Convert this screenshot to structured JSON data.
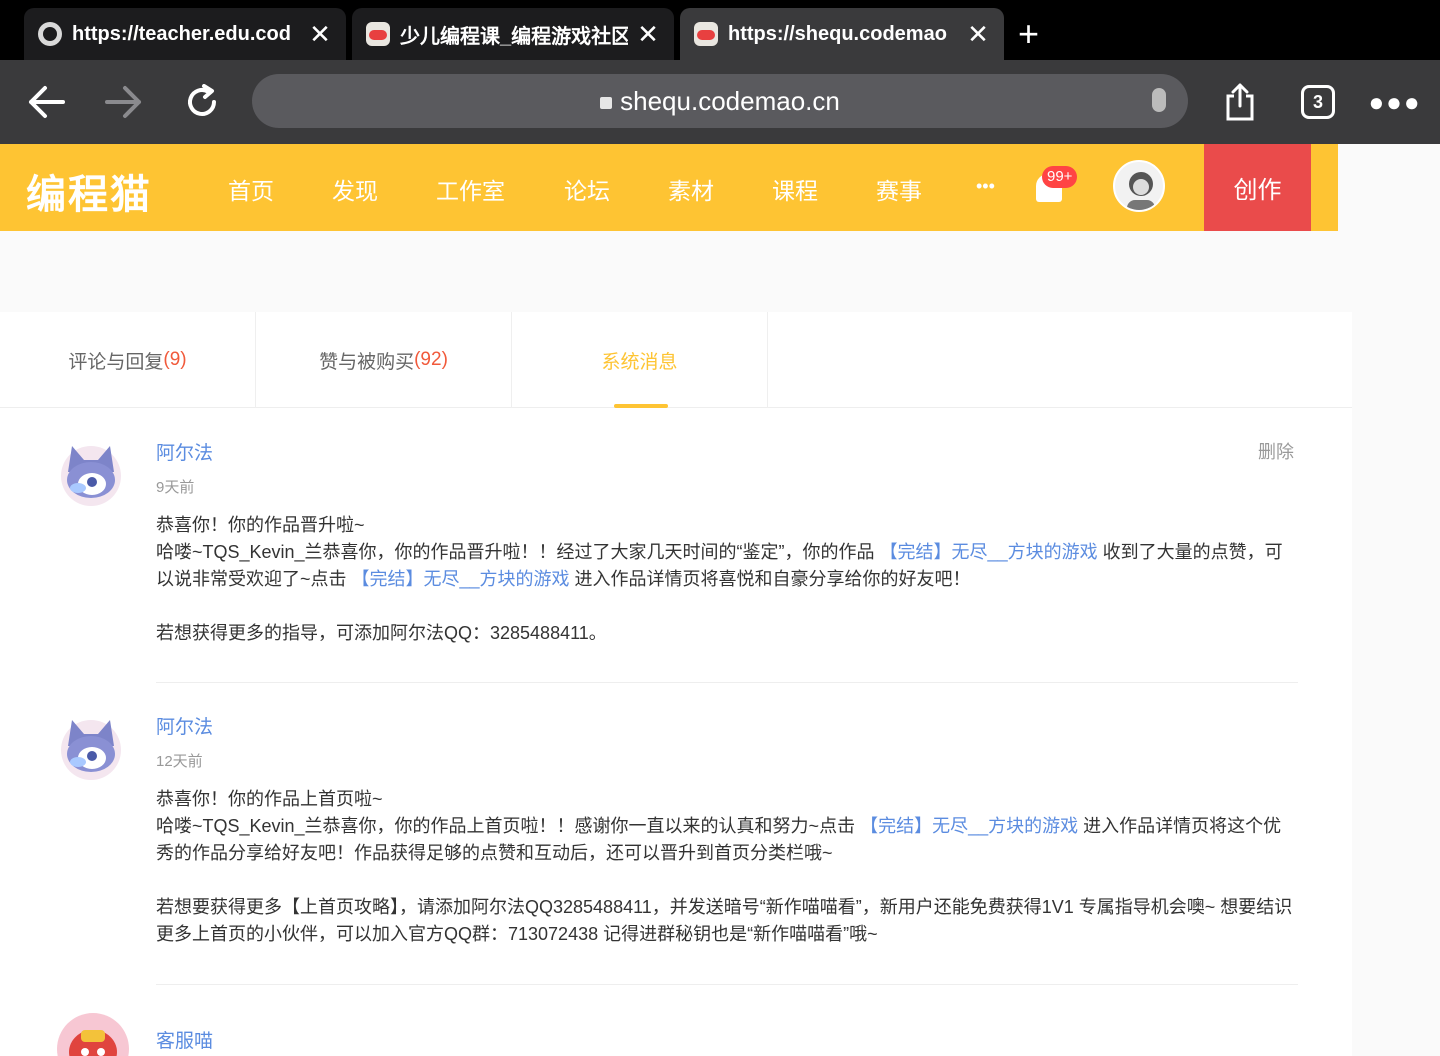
{
  "browser": {
    "tabs": [
      {
        "title": "https://teacher.edu.cod",
        "favicon": "globe-icon"
      },
      {
        "title": "少儿编程课_编程游戏社区",
        "favicon": "codemao-icon"
      },
      {
        "title": "https://shequ.codemao",
        "favicon": "codemao-icon"
      }
    ],
    "url": "sheq​u.codemao.cn",
    "tab_count": "3"
  },
  "site": {
    "logo": "编程猫",
    "nav": [
      "首页",
      "发现",
      "工作室",
      "论坛",
      "素材",
      "课程",
      "赛事",
      "•••"
    ],
    "notification_badge": "99+",
    "create_label": "创作",
    "brand_color": "#fec433"
  },
  "message_tabs": [
    {
      "label": "评论与回复",
      "count": "(9)"
    },
    {
      "label": "赞与被购买",
      "count": "(92)"
    },
    {
      "label": "系统消息",
      "count": ""
    }
  ],
  "messages": [
    {
      "sender": "阿尔法",
      "time": "9天前",
      "delete_label": "删除",
      "title": "恭喜你！你的作品晋升啦~",
      "line_a": "哈喽~TQS_Kevin_兰恭喜你，你的作品晋升啦！！经过了大家几天时间的“鉴定”，你的作品 ",
      "link_a": "【完结】无尽__方块的游戏",
      "line_b": " 收到了大量的点赞，可以说非常受欢迎了~点击 ",
      "link_b": "【完结】无尽__方块的游戏",
      "line_c": " 进入作品详情页将喜悦和自豪分享给你的好友吧！",
      "footer": "若想获得更多的指导，可添加阿尔法QQ：3285488411。"
    },
    {
      "sender": "阿尔法",
      "time": "12天前",
      "title": "恭喜你！你的作品上首页啦~",
      "line_a": "哈喽~TQS_Kevin_兰恭喜你，你的作品上首页啦！！感谢你一直以来的认真和努力~点击 ",
      "link_a": "【完结】无尽__方块的游戏",
      "line_b": " 进入作品详情页将这个优秀的作品分享给好友吧！作品获得足够的点赞和互动后，还可以晋升到首页分类栏哦~",
      "footer": "若想要获得更多【上首页攻略】，请添加阿尔法QQ3285488411，并发送暗号“新作喵喵看”，新用户还能免费获得1V1 专属指导机会噢~ 想要结识更多上首页的小伙伴，可以加入官方QQ群：713072438 记得进群秘钥也是“新作喵喵看”哦~"
    },
    {
      "sender": "客服喵"
    }
  ]
}
